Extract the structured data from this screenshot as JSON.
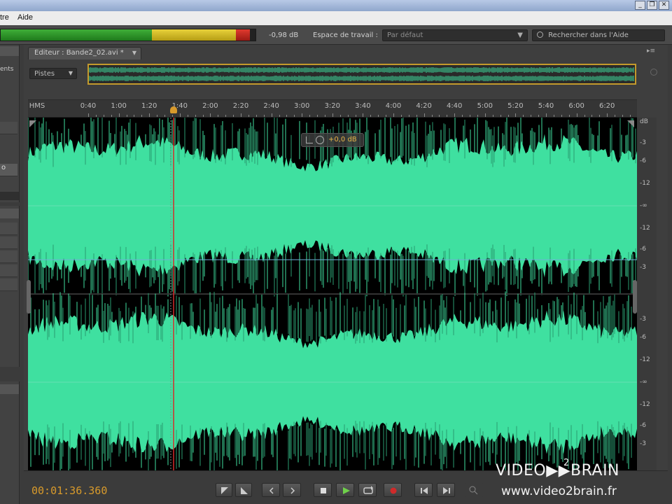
{
  "menubar": {
    "menus": [
      "tre",
      "Aide"
    ]
  },
  "window_controls": {
    "minimize": "_",
    "restore": "❐",
    "close": "✕"
  },
  "toolbar": {
    "level_readout": "-0,98 dB",
    "workspace_label": "Espace de travail :",
    "workspace_value": "Par défaut",
    "help_search_placeholder": "Rechercher dans l'Aide"
  },
  "left_panel": {
    "partial_label_1": "ents",
    "partial_label_2": "o"
  },
  "editor": {
    "tab_label": "Editeur : Bande2_02.avi *",
    "view_dropdown": "Pistes"
  },
  "ruler": {
    "unit_label": "HMS",
    "ticks": [
      "0:40",
      "1:00",
      "1:20",
      "1:40",
      "2:00",
      "2:20",
      "2:40",
      "3:00",
      "3:20",
      "3:40",
      "4:00",
      "4:20",
      "4:40",
      "5:00",
      "5:20",
      "5:40",
      "6:00",
      "6:20"
    ]
  },
  "db_scale": {
    "unit": "dB",
    "channel_top": [
      "-3",
      "-6",
      "-12",
      "-∞",
      "-12",
      "-6",
      "-3"
    ],
    "channel_bottom": [
      "-3",
      "-6",
      "-12",
      "-∞",
      "-12",
      "-6",
      "-3"
    ]
  },
  "hud": {
    "gain": "+0,0 dB"
  },
  "transport": {
    "timecode": "00:01:36.360"
  },
  "watermark": {
    "brand": "VIDEO▶▶BRAIN",
    "superscript": "2",
    "url": "www.video2brain.fr"
  },
  "colors": {
    "waveform": "#3fe0a0",
    "waveform_dark": "#2a9c70",
    "timecode": "#d89a2b",
    "selection_border": "#c39a2c",
    "playhead": "#d62a2a"
  }
}
